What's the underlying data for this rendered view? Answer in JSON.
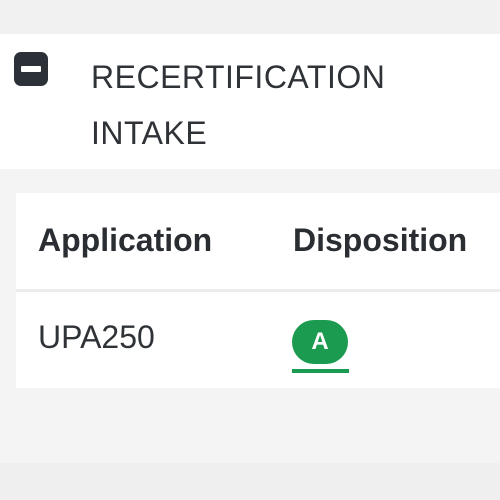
{
  "section": {
    "title": "RECERTIFICATION INTAKE",
    "toggle_icon": "minus-square-icon"
  },
  "table": {
    "headers": {
      "application": "Application",
      "disposition": "Disposition"
    },
    "rows": [
      {
        "application": "UPA250",
        "disposition": "A"
      }
    ]
  },
  "colors": {
    "disposition_badge": "#1b9b50",
    "toggle": "#2c3138",
    "text": "#2f3338"
  }
}
